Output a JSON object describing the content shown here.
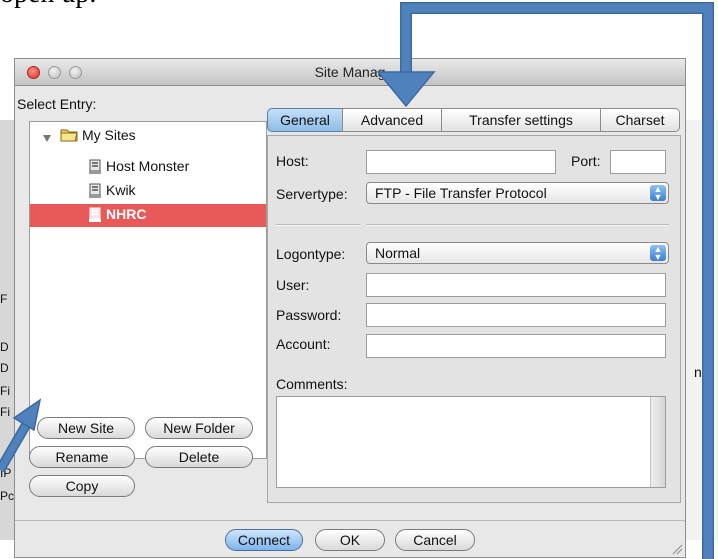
{
  "caption": "open up.",
  "window": {
    "title": "Site Manag",
    "select_entry_label": "Select Entry:"
  },
  "tree": {
    "root": "My Sites",
    "items": [
      "Host Monster",
      "Kwik",
      "NHRC"
    ]
  },
  "buttons": {
    "new_site": "New Site",
    "new_folder": "New Folder",
    "rename": "Rename",
    "delete": "Delete",
    "copy": "Copy",
    "connect": "Connect",
    "ok": "OK",
    "cancel": "Cancel"
  },
  "tabs": [
    "General",
    "Advanced",
    "Transfer settings",
    "Charset"
  ],
  "form": {
    "host_label": "Host:",
    "host_value": "",
    "port_label": "Port:",
    "port_value": "",
    "servertype_label": "Servertype:",
    "servertype_value": "FTP - File Transfer Protocol",
    "logontype_label": "Logontype:",
    "logontype_value": "Normal",
    "user_label": "User:",
    "user_value": "",
    "password_label": "Password:",
    "password_value": "",
    "account_label": "Account:",
    "account_value": "",
    "comments_label": "Comments:",
    "comments_value": ""
  },
  "background_clip": [
    "F",
    "D",
    "D",
    "Fi",
    "Fi",
    "IP",
    "Pc",
    "ne"
  ],
  "colors": {
    "selection": "#e85a5a",
    "accent": "#4f82bd",
    "tab_active": "#8fbde8"
  },
  "icons": {
    "folder": "folder-icon",
    "server": "server-icon",
    "disclosure": "disclosure-triangle-icon",
    "stepper": "popup-stepper-icon"
  }
}
